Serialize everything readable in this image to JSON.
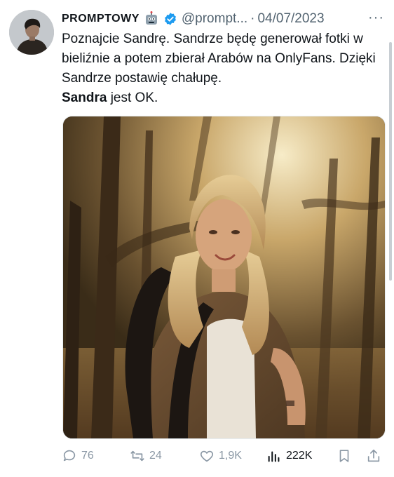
{
  "tweet": {
    "author_name": "PROMPTOWY",
    "author_emoji": "robot-emoji",
    "verified": true,
    "handle": "@prompt...",
    "separator": "·",
    "date": "04/07/2023",
    "more": "···",
    "text_line1": "Poznajcie Sandrę. Sandrze będę generował fotki w bieliźnie a potem zbierał Arabów na OnlyFans. Dzięki Sandrze postawię chałupę.",
    "text_bold": "Sandra",
    "text_rest": " jest OK."
  },
  "stats": {
    "replies": "76",
    "retweets": "24",
    "likes": "1,9K",
    "views": "222K"
  },
  "colors": {
    "verified": "#1d9bf0",
    "muted": "#536471",
    "text": "#0f1419"
  }
}
